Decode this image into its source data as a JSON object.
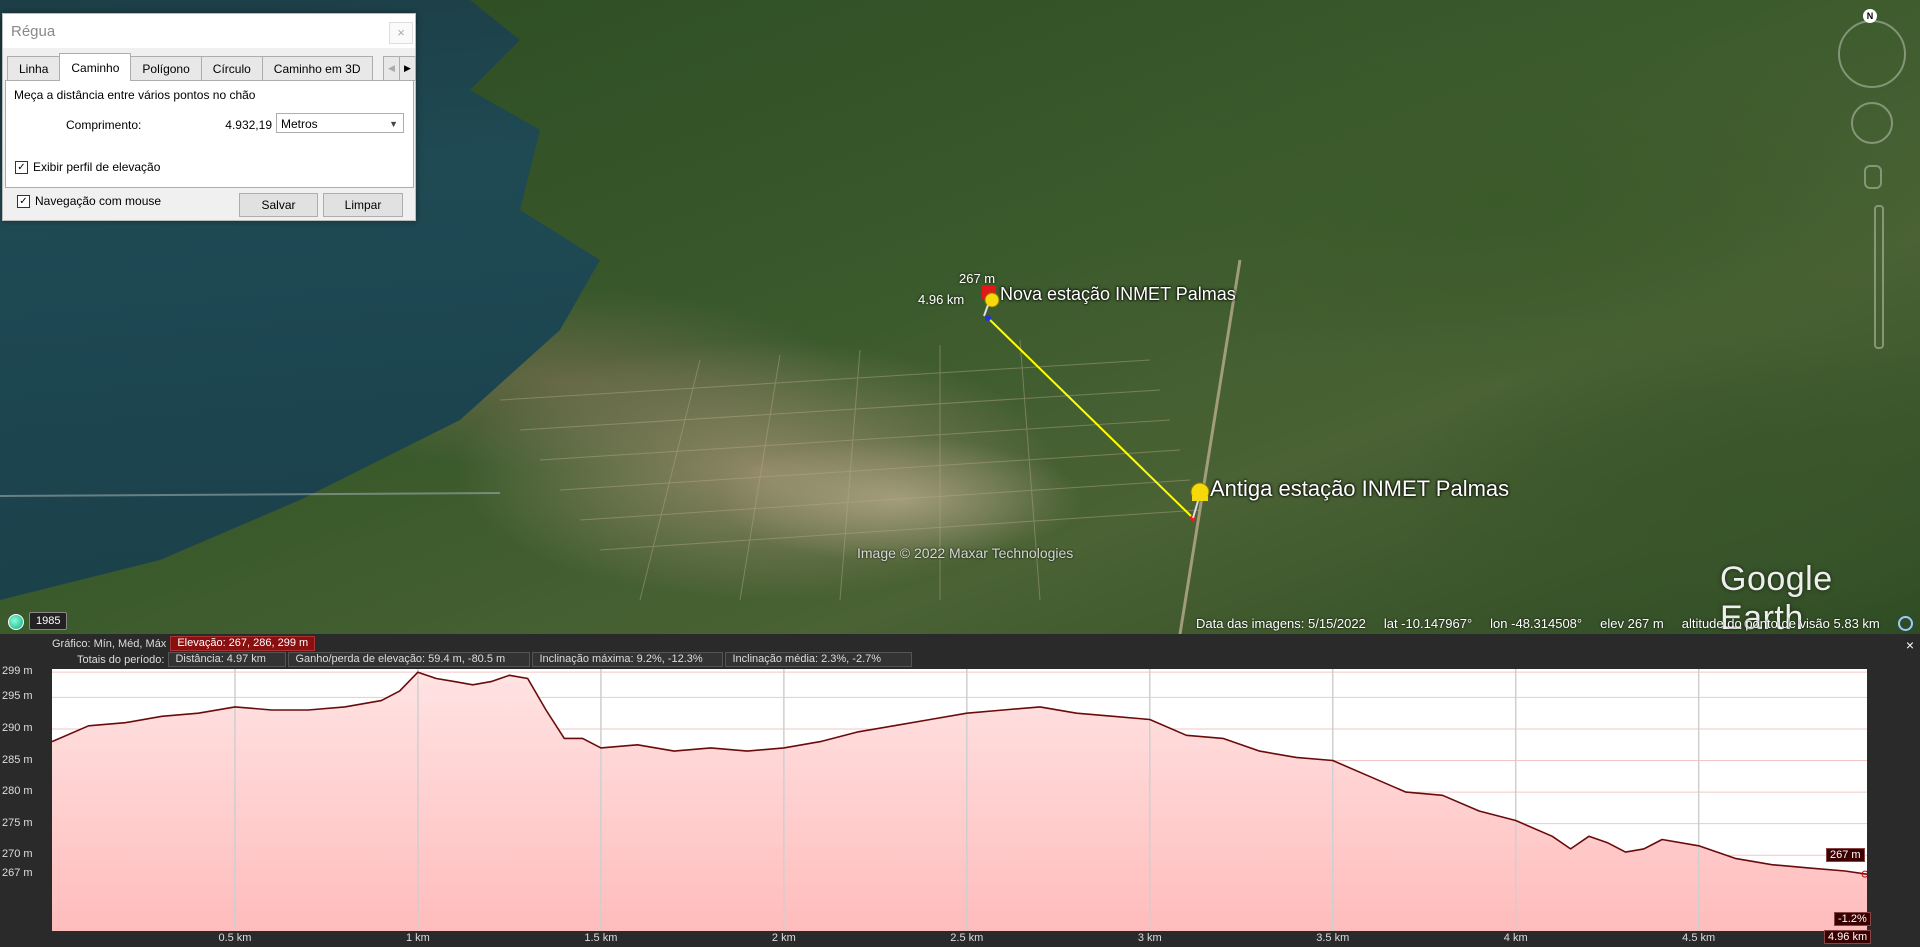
{
  "map": {
    "placemark_new": {
      "label": "Nova estação INMET Palmas",
      "elev": "267 m",
      "dist": "4.96 km"
    },
    "placemark_old": {
      "label": "Antiga estação INMET Palmas"
    },
    "copyright": "Image © 2022 Maxar Technologies",
    "logo": "Google Earth",
    "year_badge": "1985",
    "compass_letter": "N",
    "status": {
      "imagery_date": "Data das imagens: 5/15/2022",
      "lat": "lat  -10.147967°",
      "lon": "lon  -48.314508°",
      "elev": "elev   267 m",
      "eye_alt": "altitude do ponto de visão   5.83 km"
    },
    "colors": {
      "path": "#ffff00",
      "pin": "#f5d90a"
    }
  },
  "ruler": {
    "title": "Régua",
    "close": "×",
    "tabs": [
      "Linha",
      "Caminho",
      "Polígono",
      "Círculo",
      "Caminho em 3D"
    ],
    "active_tab": "Caminho",
    "description": "Meça a distância entre vários pontos no chão",
    "length_label": "Comprimento:",
    "length_value": "4.932,19",
    "unit": "Metros",
    "show_elevation_label": "Exibir perfil de elevação",
    "mouse_nav_label": "Navegação com mouse",
    "save_label": "Salvar",
    "clear_label": "Limpar"
  },
  "profile": {
    "graph_label": "Gráfico:  Mín, Méd, Máx",
    "elevation_summary": "Elevação: 267, 286, 299 m",
    "totals_label": "Totais do período:",
    "distance": "Distância: 4.97 km",
    "gain_loss": "Ganho/perda de elevação: 59.4 m, -80.5 m",
    "max_slope": "Inclinação máxima: 9.2%, -12.3%",
    "avg_slope": "Inclinação média: 2.3%, -2.7%",
    "close": "×",
    "end_elev_tag": "267 m",
    "end_slope_tag": "-1.2%",
    "end_dist_tag": "4.96 km"
  },
  "chart_data": {
    "type": "area",
    "title": "",
    "xlabel": "",
    "ylabel": "",
    "y_tick_labels": [
      "299 m",
      "295 m",
      "290 m",
      "285 m",
      "280 m",
      "275 m",
      "270 m",
      "267 m"
    ],
    "y_ticks": [
      299,
      295,
      290,
      285,
      280,
      275,
      270,
      267
    ],
    "x_tick_labels": [
      "0.5 km",
      "1 km",
      "1.5 km",
      "2 km",
      "2.5 km",
      "3 km",
      "3.5 km",
      "4 km",
      "4.5 km"
    ],
    "x_ticks": [
      0.5,
      1,
      1.5,
      2,
      2.5,
      3,
      3.5,
      4,
      4.5
    ],
    "xlim": [
      0,
      4.96
    ],
    "ylim": [
      258,
      299.5
    ],
    "grid": true,
    "series": [
      {
        "x": [
          0,
          0.1,
          0.2,
          0.3,
          0.4,
          0.5,
          0.6,
          0.7,
          0.8,
          0.9,
          0.95,
          1.0,
          1.05,
          1.1,
          1.15,
          1.2,
          1.25,
          1.3,
          1.35,
          1.4,
          1.45,
          1.5,
          1.6,
          1.7,
          1.8,
          1.9,
          2.0,
          2.1,
          2.2,
          2.3,
          2.4,
          2.5,
          2.6,
          2.7,
          2.8,
          2.9,
          3.0,
          3.1,
          3.2,
          3.3,
          3.4,
          3.5,
          3.6,
          3.7,
          3.8,
          3.9,
          4.0,
          4.1,
          4.15,
          4.2,
          4.25,
          4.3,
          4.35,
          4.4,
          4.5,
          4.6,
          4.7,
          4.8,
          4.9,
          4.96
        ],
        "y": [
          288,
          290.5,
          291,
          292,
          292.5,
          293.5,
          293,
          293,
          293.5,
          294.5,
          296,
          299,
          298,
          297.5,
          297,
          297.5,
          298.5,
          298,
          293,
          288.5,
          288.5,
          287,
          287.5,
          286.5,
          287,
          286.5,
          287,
          288,
          289.5,
          290.5,
          291.5,
          292.5,
          293,
          293.5,
          292.5,
          292,
          291.5,
          289,
          288.5,
          286.5,
          285.5,
          285,
          282.5,
          280,
          279.5,
          277,
          275.5,
          273,
          271,
          273,
          272,
          270.5,
          271,
          272.5,
          271.5,
          269.5,
          268.5,
          268,
          267.5,
          267
        ]
      }
    ]
  }
}
